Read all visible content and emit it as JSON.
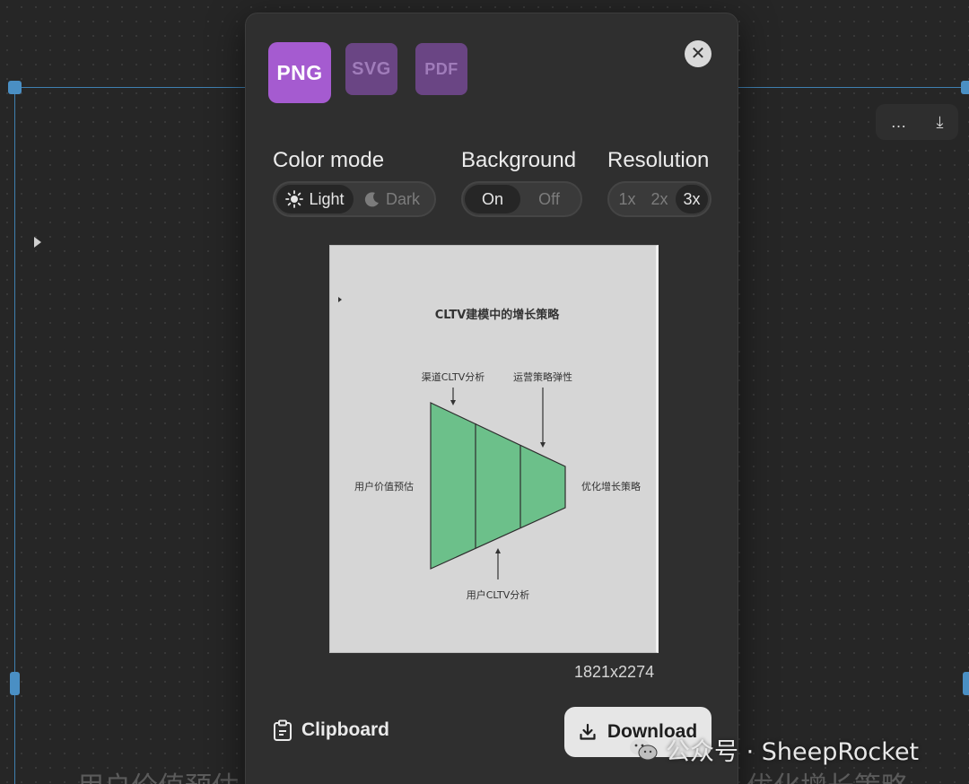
{
  "background": {
    "toolbar": {
      "more_icon": "…",
      "download_icon": "⤓"
    },
    "bottom_text_left": "用户价值预估",
    "bottom_text_right": "优化增长策略"
  },
  "modal": {
    "formats": [
      {
        "label": "PNG",
        "selected": true
      },
      {
        "label": "SVG",
        "selected": false
      },
      {
        "label": "PDF",
        "selected": false
      }
    ],
    "close_icon": "✕",
    "color_mode": {
      "label": "Color mode",
      "options": [
        "Light",
        "Dark"
      ],
      "selected": "Light"
    },
    "background": {
      "label": "Background",
      "options": [
        "On",
        "Off"
      ],
      "selected": "On"
    },
    "resolution": {
      "label": "Resolution",
      "options": [
        "1x",
        "2x",
        "3x"
      ],
      "selected": "3x"
    },
    "preview": {
      "title": "CLTV建模中的增长策略",
      "label_top_left": "渠道CLTV分析",
      "label_top_right": "运营策略弹性",
      "label_left": "用户价值预估",
      "label_right": "优化增长策略",
      "label_bottom": "用户CLTV分析",
      "fill_color": "#6cc08a"
    },
    "dimensions": "1821x2274",
    "clipboard_label": "Clipboard",
    "download_label": "Download"
  },
  "watermark": "公众号 · SheepRocket",
  "colors": {
    "accent": "#a55bd0",
    "selection": "#3f7fb0"
  }
}
